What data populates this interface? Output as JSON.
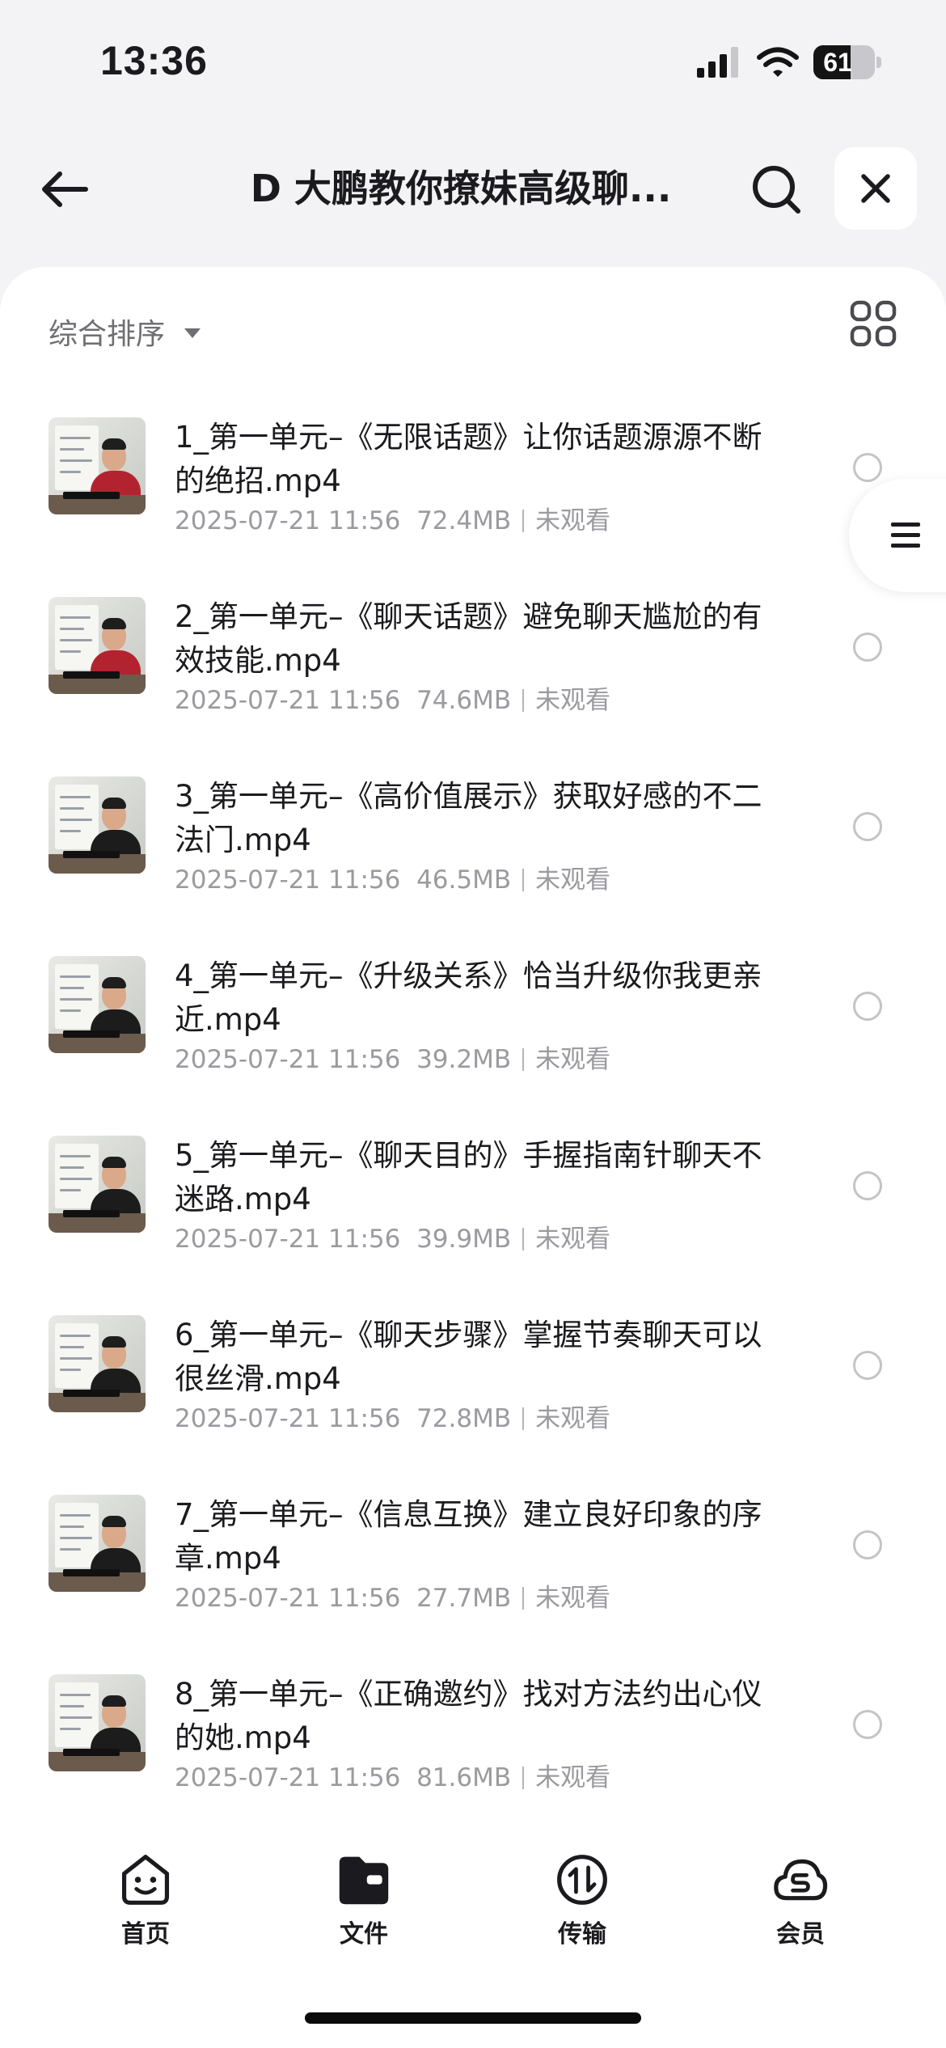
{
  "status_bar": {
    "time": "13:36",
    "battery": "61",
    "battery_level": 0.61
  },
  "header": {
    "title": "D 大鹏教你撩妹高级聊...",
    "back_icon": "arrow-left-icon",
    "search_icon": "search-icon",
    "close_icon": "close-icon"
  },
  "toolbar": {
    "sort_label": "综合排序",
    "view_icon": "grid-view-icon"
  },
  "files": [
    {
      "title": "1_第一单元–《无限话题》让你话题源源不断的绝招.mp4",
      "date": "2025-07-21 11:56",
      "size": "72.4MB",
      "status": "未观看",
      "shirt": "#b3232f"
    },
    {
      "title": "2_第一单元–《聊天话题》避免聊天尴尬的有效技能.mp4",
      "date": "2025-07-21 11:56",
      "size": "74.6MB",
      "status": "未观看",
      "shirt": "#b3232f"
    },
    {
      "title": "3_第一单元–《高价值展示》获取好感的不二法门.mp4",
      "date": "2025-07-21 11:56",
      "size": "46.5MB",
      "status": "未观看",
      "shirt": "#1c1c1c"
    },
    {
      "title": "4_第一单元–《升级关系》恰当升级你我更亲近.mp4",
      "date": "2025-07-21 11:56",
      "size": "39.2MB",
      "status": "未观看",
      "shirt": "#1c1c1c"
    },
    {
      "title": "5_第一单元–《聊天目的》手握指南针聊天不迷路.mp4",
      "date": "2025-07-21 11:56",
      "size": "39.9MB",
      "status": "未观看",
      "shirt": "#1c1c1c"
    },
    {
      "title": "6_第一单元–《聊天步骤》掌握节奏聊天可以很丝滑.mp4",
      "date": "2025-07-21 11:56",
      "size": "72.8MB",
      "status": "未观看",
      "shirt": "#1c1c1c"
    },
    {
      "title": "7_第一单元–《信息互换》建立良好印象的序章.mp4",
      "date": "2025-07-21 11:56",
      "size": "27.7MB",
      "status": "未观看",
      "shirt": "#1c1c1c"
    },
    {
      "title": "8_第一单元–《正确邀约》找对方法约出心仪的她.mp4",
      "date": "2025-07-21 11:56",
      "size": "81.6MB",
      "status": "未观看",
      "shirt": "#1c1c1c"
    }
  ],
  "side_handle": {
    "icon": "menu-lines-icon"
  },
  "tabbar": {
    "tabs": [
      {
        "label": "首页",
        "icon": "smiley-home-icon"
      },
      {
        "label": "文件",
        "icon": "folder-icon"
      },
      {
        "label": "传输",
        "icon": "transfer-icon"
      },
      {
        "label": "会员",
        "icon": "cloud-member-icon"
      }
    ]
  }
}
